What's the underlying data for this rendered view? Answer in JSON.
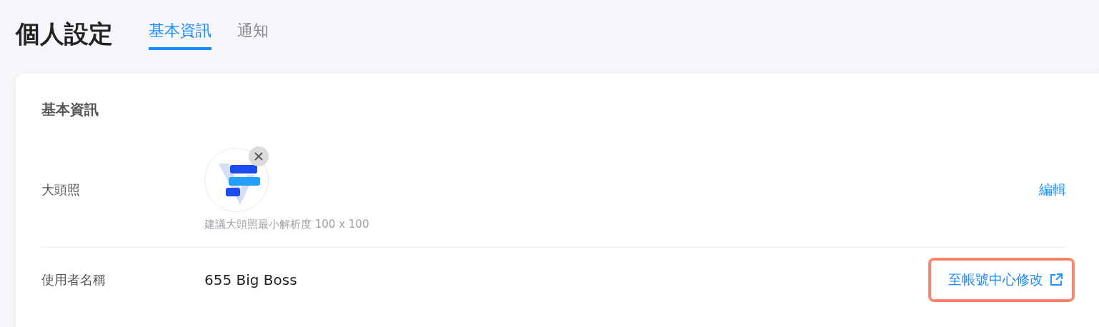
{
  "page_title": "個人設定",
  "tabs": [
    {
      "label": "基本資訊",
      "selected": true
    },
    {
      "label": "通知",
      "selected": false
    }
  ],
  "section_title": "基本資訊",
  "avatar_row": {
    "label": "大頭照",
    "hint": "建議大頭照最小解析度 100 x 100",
    "removable": true,
    "action": "編輯"
  },
  "username_row": {
    "label": "使用者名稱",
    "value": "655 Big Boss",
    "action": "至帳號中心修改",
    "highlighted": true
  }
}
